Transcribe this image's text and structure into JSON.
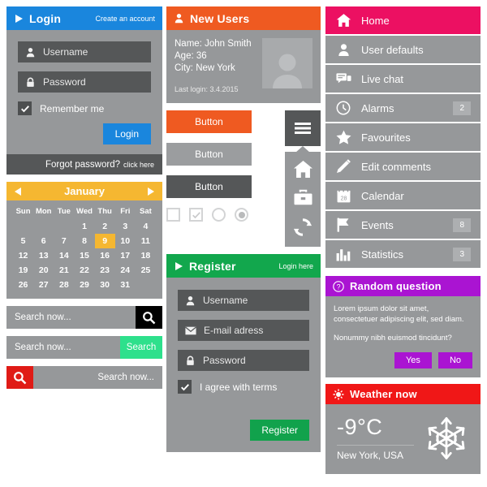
{
  "colors": {
    "page_bg": "#ffffff",
    "panel_gray": "#96989a",
    "field_dark": "#555758",
    "login_blue": "#1a86dd",
    "calendar_yellow": "#f5b731",
    "new_users_orange": "#ef5a21",
    "register_green": "#12a74d",
    "menu_pink": "#ec1062",
    "question_purple": "#aa14d2",
    "weather_red": "#f01717",
    "search_green": "#2ee08c",
    "search_red": "#e01b16",
    "search_black": "#000000"
  },
  "login": {
    "icon": "play-icon",
    "title": "Login",
    "create_account_link": "Create an account",
    "username_placeholder": "Username",
    "username_icon": "user-icon",
    "password_placeholder": "Password",
    "password_icon": "lock-icon",
    "remember_label": "Remember me",
    "remember_checked": true,
    "submit_label": "Login",
    "forgot_label": "Forgot password?",
    "forgot_link": "click here"
  },
  "calendar": {
    "month": "January",
    "prev_icon": "triangle-left-icon",
    "next_icon": "triangle-right-icon",
    "day_headers": [
      "Sun",
      "Mon",
      "Tue",
      "Wed",
      "Thu",
      "Fri",
      "Sat"
    ],
    "leading_blanks": 3,
    "days": [
      1,
      2,
      3,
      4,
      5,
      6,
      7,
      8,
      9,
      10,
      11,
      12,
      13,
      14,
      15,
      16,
      17,
      18,
      19,
      20,
      21,
      22,
      23,
      24,
      25,
      26,
      27,
      28,
      29,
      30,
      31
    ],
    "today": 9
  },
  "search_bars": [
    {
      "placeholder": "Search now...",
      "button_label": "",
      "button_icon": "magnifier-icon",
      "button_style": "black",
      "align": "left"
    },
    {
      "placeholder": "Search now...",
      "button_label": "Search",
      "button_icon": "",
      "button_style": "green",
      "align": "left"
    },
    {
      "placeholder": "Search now...",
      "button_label": "",
      "button_icon": "magnifier-icon",
      "button_style": "red",
      "align": "right"
    }
  ],
  "new_users": {
    "icon": "user-icon",
    "title": "New Users",
    "name_line": "Name: John Smith",
    "age_line": "Age: 36",
    "city_line": "City: New York",
    "last_login": "Last login: 3.4.2015",
    "avatar_icon": "avatar-placeholder-icon"
  },
  "buttons": {
    "orange_label": "Button",
    "gray_label": "Button",
    "dark_label": "Button",
    "toggles": [
      {
        "name": "checkbox-unchecked",
        "checked": false
      },
      {
        "name": "checkbox-checked",
        "checked": true
      },
      {
        "name": "radio-unselected",
        "selected": false
      },
      {
        "name": "radio-selected",
        "selected": true
      }
    ]
  },
  "icon_menu": {
    "burger_icon": "hamburger-icon",
    "items": [
      {
        "icon": "home-icon",
        "name": "home"
      },
      {
        "icon": "briefcase-icon",
        "name": "briefcase"
      },
      {
        "icon": "refresh-icon",
        "name": "refresh"
      }
    ]
  },
  "register": {
    "icon": "play-icon",
    "title": "Register",
    "login_link": "Login here",
    "username_placeholder": "Username",
    "username_icon": "user-icon",
    "email_placeholder": "E-mail adress",
    "email_icon": "envelope-icon",
    "password_placeholder": "Password",
    "password_icon": "lock-icon",
    "terms_label": "I agree with terms",
    "terms_checked": true,
    "submit_label": "Register"
  },
  "menu": {
    "items": [
      {
        "label": "Home",
        "icon": "home-icon",
        "badge": "",
        "active": true
      },
      {
        "label": "User defaults",
        "icon": "user-icon",
        "badge": "",
        "active": false
      },
      {
        "label": "Live chat",
        "icon": "chat-icon",
        "badge": "",
        "active": false
      },
      {
        "label": "Alarms",
        "icon": "clock-icon",
        "badge": "2",
        "active": false
      },
      {
        "label": "Favourites",
        "icon": "star-icon",
        "badge": "",
        "active": false
      },
      {
        "label": "Edit comments",
        "icon": "pencil-icon",
        "badge": "",
        "active": false
      },
      {
        "label": "Calendar",
        "icon": "calendar-icon",
        "badge": "",
        "active": false
      },
      {
        "label": "Events",
        "icon": "flag-icon",
        "badge": "8",
        "active": false
      },
      {
        "label": "Statistics",
        "icon": "bar-chart-icon",
        "badge": "3",
        "active": false
      }
    ]
  },
  "question": {
    "icon": "question-mark-icon",
    "title": "Random question",
    "body_text": "Lorem ipsum dolor sit amet, consectetuer adipiscing elit, sed diam.",
    "prompt_text": "Nonummy nibh euismod tincidunt?",
    "yes_label": "Yes",
    "no_label": "No"
  },
  "weather": {
    "icon": "sun-icon",
    "title": "Weather now",
    "temperature": "-9°C",
    "location": "New York, USA",
    "condition_icon": "snowflake-icon"
  }
}
